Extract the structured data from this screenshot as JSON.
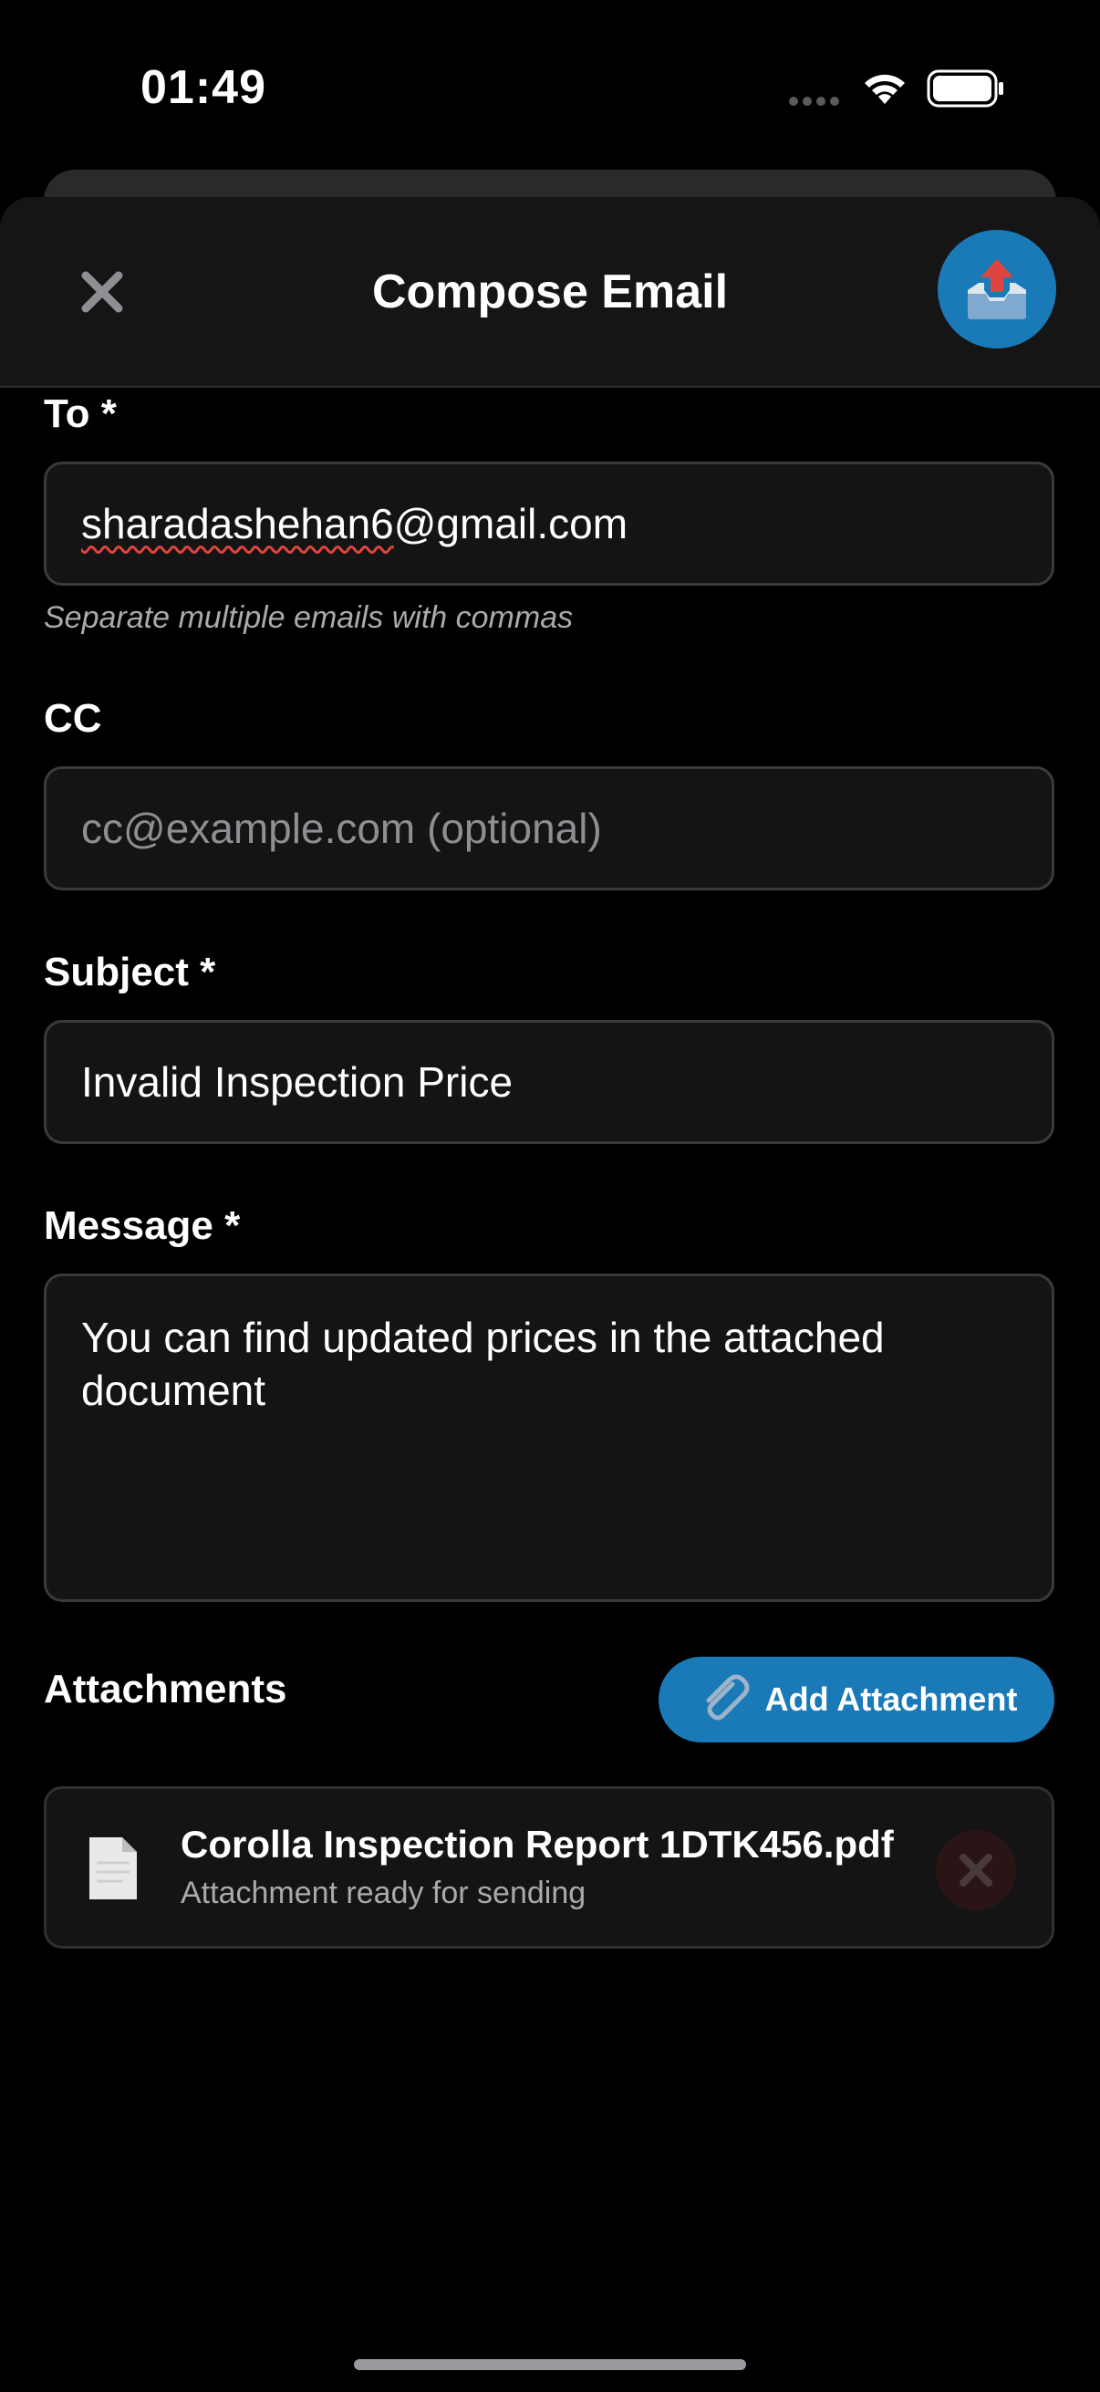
{
  "status_bar": {
    "time": "01:49"
  },
  "header": {
    "title": "Compose Email",
    "close_icon": "close-x-icon",
    "send_icon": "outbox-tray-icon"
  },
  "form": {
    "to": {
      "label": "To *",
      "value_misspelled": "sharadashehan6",
      "value_rest": "@gmail.com",
      "hint": "Separate multiple emails with commas"
    },
    "cc": {
      "label": "CC",
      "placeholder": "cc@example.com (optional)"
    },
    "subject": {
      "label": "Subject *",
      "value": "Invalid Inspection Price"
    },
    "message": {
      "label": "Message *",
      "value": "You can find updated prices in the attached document"
    }
  },
  "attachments": {
    "label": "Attachments",
    "add_button_label": "Add Attachment",
    "items": [
      {
        "name": "Corolla Inspection Report 1DTK456.pdf",
        "status": "Attachment ready for sending"
      }
    ]
  },
  "colors": {
    "accent": "#1a7ab8",
    "background": "#000000",
    "field_background": "#141415",
    "field_border": "#3a3a3c",
    "remove_button_background": "#2a1415"
  }
}
